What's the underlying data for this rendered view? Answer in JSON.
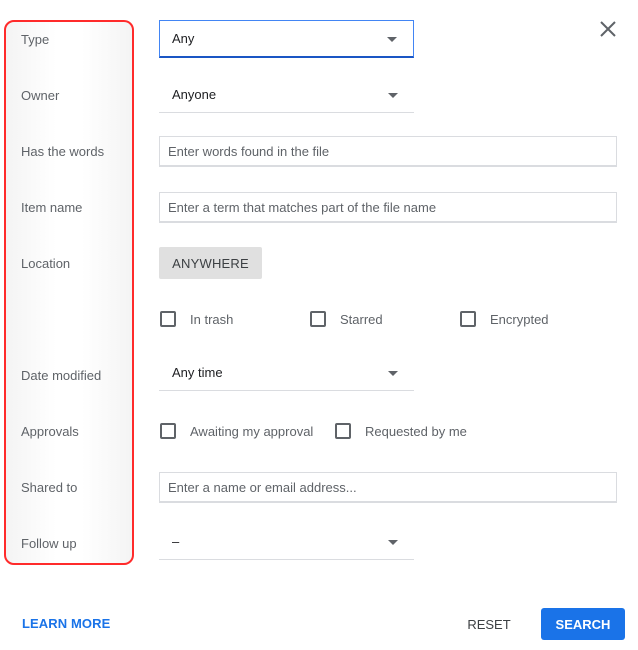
{
  "labels": {
    "type": "Type",
    "owner": "Owner",
    "has_words": "Has the words",
    "item_name": "Item name",
    "location": "Location",
    "date_modified": "Date modified",
    "approvals": "Approvals",
    "shared_to": "Shared to",
    "follow_up": "Follow up"
  },
  "fields": {
    "type": {
      "value": "Any"
    },
    "owner": {
      "value": "Anyone"
    },
    "has_words": {
      "value": "",
      "placeholder": "Enter words found in the file"
    },
    "item_name": {
      "value": "",
      "placeholder": "Enter a term that matches part of the file name"
    },
    "location": {
      "button_label": "ANYWHERE"
    },
    "location_filters": [
      {
        "label": "In trash",
        "checked": false
      },
      {
        "label": "Starred",
        "checked": false
      },
      {
        "label": "Encrypted",
        "checked": false
      }
    ],
    "date_modified": {
      "value": "Any time"
    },
    "approvals": [
      {
        "label": "Awaiting my approval",
        "checked": false
      },
      {
        "label": "Requested by me",
        "checked": false
      }
    ],
    "shared_to": {
      "value": "",
      "placeholder": "Enter a name or email address..."
    },
    "follow_up": {
      "value": "–"
    }
  },
  "footer": {
    "learn_more": "LEARN MORE",
    "reset": "RESET",
    "search": "SEARCH"
  },
  "icons": {
    "close": "close-icon",
    "dropdown": "caret-down-icon",
    "checkbox": "checkbox-unchecked-icon"
  },
  "colors": {
    "accent": "#1a73e8",
    "highlight_border": "#ff2b2b",
    "focus_underline": "#1a56c4"
  }
}
